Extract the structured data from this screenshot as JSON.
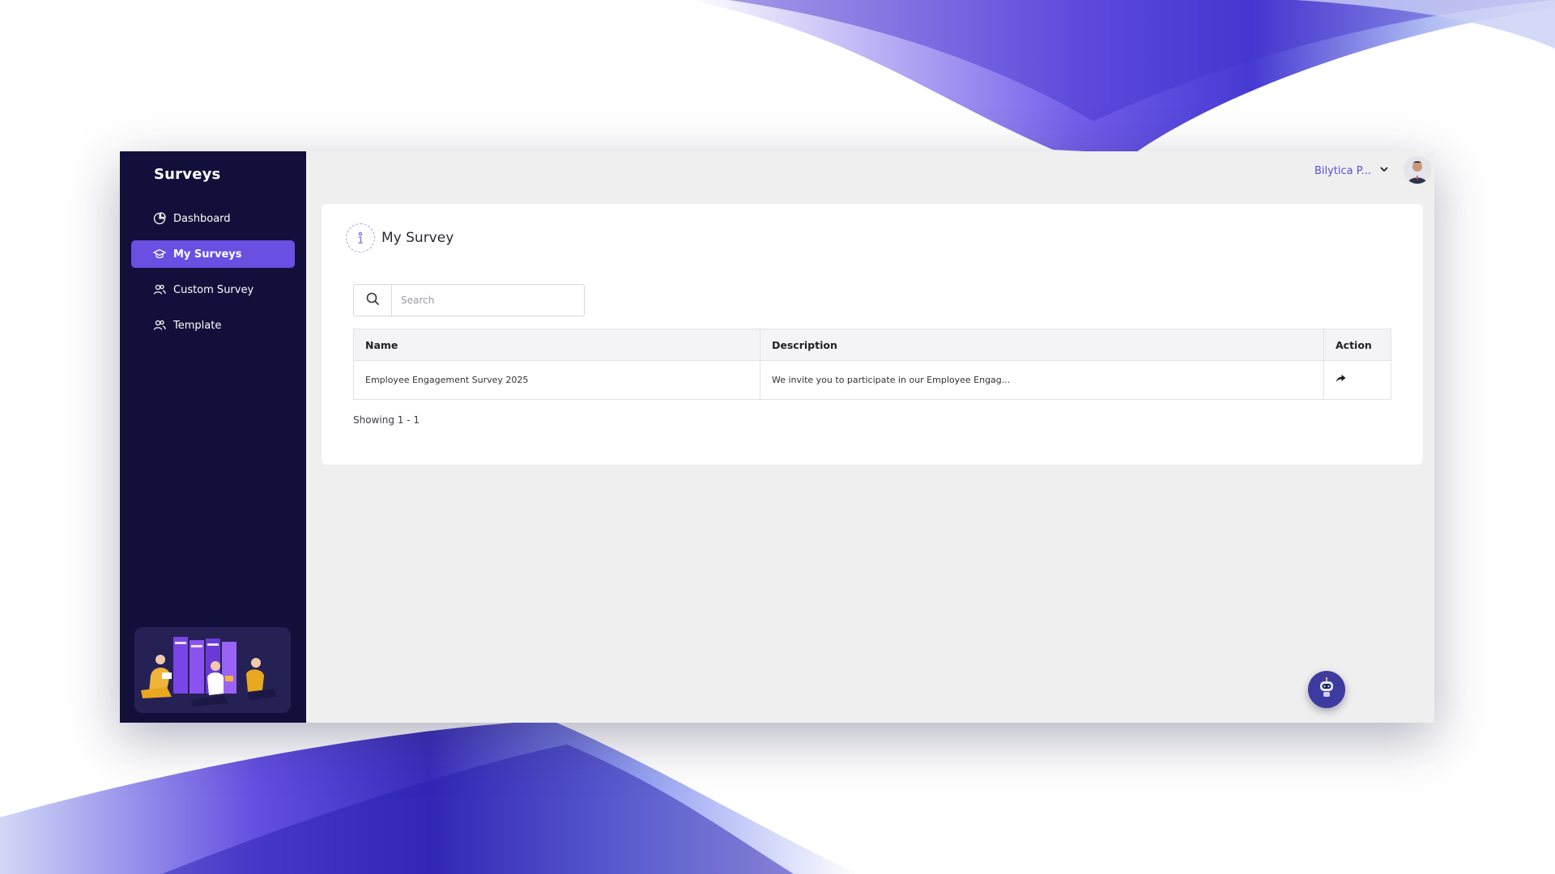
{
  "sidebar": {
    "brand": "Surveys",
    "items": [
      {
        "label": "Dashboard",
        "icon": "chart-pie-icon",
        "active": false
      },
      {
        "label": "My Surveys",
        "icon": "graduation-cap-icon",
        "active": true
      },
      {
        "label": "Custom Survey",
        "icon": "users-icon",
        "active": false
      },
      {
        "label": "Template",
        "icon": "users-icon",
        "active": false
      }
    ]
  },
  "header": {
    "user_name": "Bilytica P...",
    "avatar_icon": "user-avatar-icon"
  },
  "main": {
    "title": "My Survey",
    "title_icon": "info-icon",
    "search": {
      "placeholder": "Search",
      "value": ""
    },
    "table": {
      "columns": [
        "Name",
        "Description",
        "Action"
      ],
      "rows": [
        {
          "name": "Employee Engagement Survey 2025",
          "description": "We invite you to participate in our Employee Engag...",
          "action_icon": "share-arrow-icon"
        }
      ]
    },
    "pagination_text": "Showing 1 - 1"
  },
  "chatbot": {
    "icon": "robot-icon"
  },
  "colors": {
    "sidebar_bg": "#120f3a",
    "accent": "#6a4fe2",
    "user_link": "#5a4fd6"
  }
}
